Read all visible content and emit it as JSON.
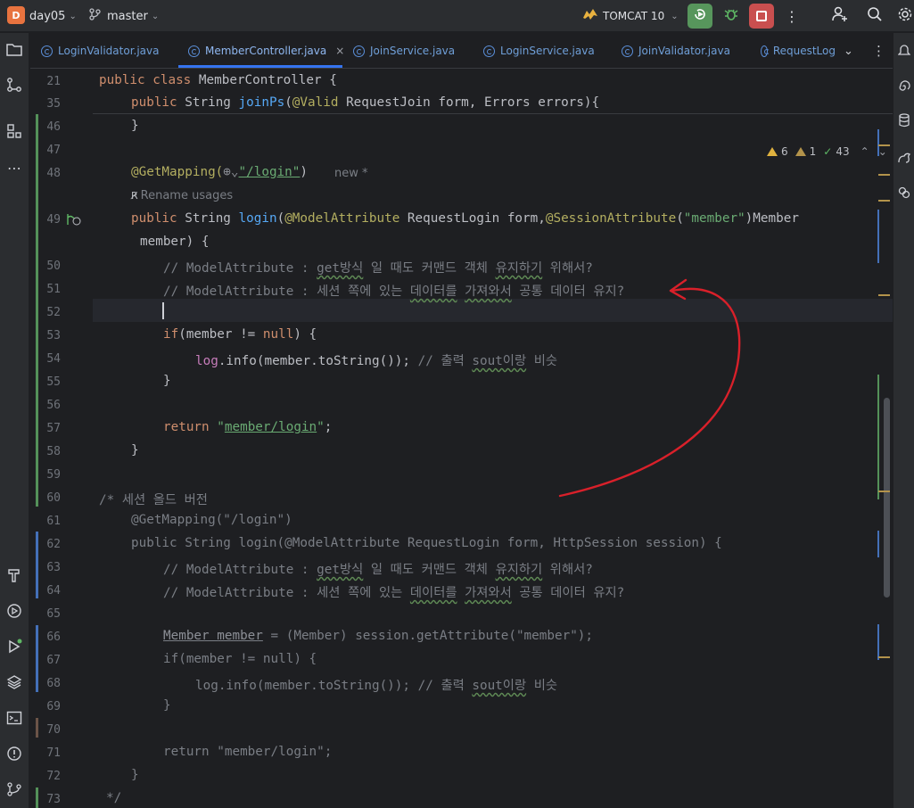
{
  "topbar": {
    "project_badge": "D",
    "project_name": "day05",
    "branch": "master",
    "run_config": "TOMCAT 10",
    "icons": [
      "branch-icon",
      "tomcat-icon",
      "run-icon",
      "debug-icon",
      "stop-icon",
      "more-icon",
      "add-user-icon",
      "search-icon",
      "settings-icon"
    ]
  },
  "tabs": [
    {
      "label": "LoginValidator.java"
    },
    {
      "label": "MemberController.java",
      "active": true
    },
    {
      "label": "JoinService.java"
    },
    {
      "label": "LoginService.java"
    },
    {
      "label": "JoinValidator.java"
    },
    {
      "label": "RequestLog"
    }
  ],
  "tab_close": "×",
  "inspections": {
    "warnings": "6",
    "weak_warnings": "1",
    "ok": "43"
  },
  "hints": {
    "new": "new *",
    "rename": "Rename usages"
  },
  "gutter": [
    "21",
    "35",
    "46",
    "47",
    "48",
    "49",
    "50",
    "51",
    "52",
    "53",
    "54",
    "55",
    "56",
    "57",
    "58",
    "59",
    "60",
    "61",
    "62",
    "63",
    "64",
    "65",
    "66",
    "67",
    "68",
    "69",
    "70",
    "71",
    "72",
    "73"
  ],
  "code": {
    "l21_a": "public class ",
    "l21_b": "MemberController {",
    "l35_a": "public ",
    "l35_b": "String ",
    "l35_c": "joinPs",
    "l35_d": "(",
    "l35_e": "@Valid ",
    "l35_f": "RequestJoin form, Errors errors){",
    "l46": "}",
    "l48_a": "@GetMapping(",
    "l48_globe": "⊕⌄",
    "l48_b": "\"/login\"",
    "l48_c": ")",
    "l49_a": "public ",
    "l49_b": "String ",
    "l49_c": "login",
    "l49_d": "(",
    "l49_e": "@ModelAttribute ",
    "l49_f": "RequestLogin form,",
    "l49_g": "@SessionAttribute",
    "l49_h": "(",
    "l49_i": "\"member\"",
    "l49_j": ")Member",
    "l49_cont": "member) {",
    "l50_a": "// ModelAttribute : ",
    "l50_b": "get방식",
    "l50_c": " 일 때도 커맨드 객체 ",
    "l50_d": "유지하기",
    "l50_e": " 위해서?",
    "l51_a": "// ModelAttribute : 세션 쪽에 있는 ",
    "l51_b": "데이터를",
    "l51_c": " ",
    "l51_d": "가져와서",
    "l51_e": " 공통 데이터 유지?",
    "l53_a": "if",
    "l53_b": "(member != ",
    "l53_c": "null",
    "l53_d": ") {",
    "l54_a": "log",
    "l54_b": ".info(member.toString()); ",
    "l54_c": "// 출력 ",
    "l54_d": "sout이랑",
    "l54_e": " 비슷",
    "l55": "}",
    "l57_a": "return ",
    "l57_b": "\"",
    "l57_c": "member/login",
    "l57_d": "\"",
    "l57_e": ";",
    "l58": "}",
    "l60": "/* 세션 올드 버전",
    "l61": "@GetMapping(\"/login\")",
    "l62": "public String login(@ModelAttribute RequestLogin form, HttpSession session) {",
    "l63_a": "// ModelAttribute : ",
    "l63_b": "get방식",
    "l63_c": " 일 때도 커맨드 객체 ",
    "l63_d": "유지하기",
    "l63_e": " 위해서?",
    "l64_a": "// ModelAttribute : 세션 쪽에 있는 ",
    "l64_b": "데이터를",
    "l64_c": " ",
    "l64_d": "가져와서",
    "l64_e": " 공통 데이터 유지?",
    "l66_a": "Member member",
    "l66_b": " = (Member) session.getAttribute(\"member\");",
    "l67": "if(member != null) {",
    "l68_a": "log.info(member.toString()); // 출력 ",
    "l68_b": "sout이랑",
    "l68_c": " 비슷",
    "l69": "}",
    "l71": "return \"member/login\";",
    "l72": "}",
    "l73": "*/"
  },
  "colors": {
    "accent": "#3574f0",
    "annotation_arrow": "#d9202a"
  }
}
